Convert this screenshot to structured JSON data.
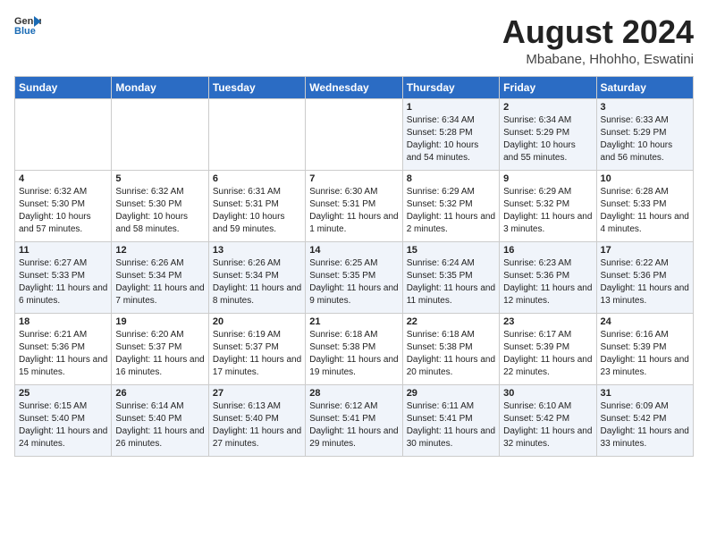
{
  "header": {
    "logo_general": "General",
    "logo_blue": "Blue",
    "month_year": "August 2024",
    "location": "Mbabane, Hhohho, Eswatini"
  },
  "weekdays": [
    "Sunday",
    "Monday",
    "Tuesday",
    "Wednesday",
    "Thursday",
    "Friday",
    "Saturday"
  ],
  "weeks": [
    [
      {
        "day": "",
        "info": ""
      },
      {
        "day": "",
        "info": ""
      },
      {
        "day": "",
        "info": ""
      },
      {
        "day": "",
        "info": ""
      },
      {
        "day": "1",
        "info": "Sunrise: 6:34 AM\nSunset: 5:28 PM\nDaylight: 10 hours and 54 minutes."
      },
      {
        "day": "2",
        "info": "Sunrise: 6:34 AM\nSunset: 5:29 PM\nDaylight: 10 hours and 55 minutes."
      },
      {
        "day": "3",
        "info": "Sunrise: 6:33 AM\nSunset: 5:29 PM\nDaylight: 10 hours and 56 minutes."
      }
    ],
    [
      {
        "day": "4",
        "info": "Sunrise: 6:32 AM\nSunset: 5:30 PM\nDaylight: 10 hours and 57 minutes."
      },
      {
        "day": "5",
        "info": "Sunrise: 6:32 AM\nSunset: 5:30 PM\nDaylight: 10 hours and 58 minutes."
      },
      {
        "day": "6",
        "info": "Sunrise: 6:31 AM\nSunset: 5:31 PM\nDaylight: 10 hours and 59 minutes."
      },
      {
        "day": "7",
        "info": "Sunrise: 6:30 AM\nSunset: 5:31 PM\nDaylight: 11 hours and 1 minute."
      },
      {
        "day": "8",
        "info": "Sunrise: 6:29 AM\nSunset: 5:32 PM\nDaylight: 11 hours and 2 minutes."
      },
      {
        "day": "9",
        "info": "Sunrise: 6:29 AM\nSunset: 5:32 PM\nDaylight: 11 hours and 3 minutes."
      },
      {
        "day": "10",
        "info": "Sunrise: 6:28 AM\nSunset: 5:33 PM\nDaylight: 11 hours and 4 minutes."
      }
    ],
    [
      {
        "day": "11",
        "info": "Sunrise: 6:27 AM\nSunset: 5:33 PM\nDaylight: 11 hours and 6 minutes."
      },
      {
        "day": "12",
        "info": "Sunrise: 6:26 AM\nSunset: 5:34 PM\nDaylight: 11 hours and 7 minutes."
      },
      {
        "day": "13",
        "info": "Sunrise: 6:26 AM\nSunset: 5:34 PM\nDaylight: 11 hours and 8 minutes."
      },
      {
        "day": "14",
        "info": "Sunrise: 6:25 AM\nSunset: 5:35 PM\nDaylight: 11 hours and 9 minutes."
      },
      {
        "day": "15",
        "info": "Sunrise: 6:24 AM\nSunset: 5:35 PM\nDaylight: 11 hours and 11 minutes."
      },
      {
        "day": "16",
        "info": "Sunrise: 6:23 AM\nSunset: 5:36 PM\nDaylight: 11 hours and 12 minutes."
      },
      {
        "day": "17",
        "info": "Sunrise: 6:22 AM\nSunset: 5:36 PM\nDaylight: 11 hours and 13 minutes."
      }
    ],
    [
      {
        "day": "18",
        "info": "Sunrise: 6:21 AM\nSunset: 5:36 PM\nDaylight: 11 hours and 15 minutes."
      },
      {
        "day": "19",
        "info": "Sunrise: 6:20 AM\nSunset: 5:37 PM\nDaylight: 11 hours and 16 minutes."
      },
      {
        "day": "20",
        "info": "Sunrise: 6:19 AM\nSunset: 5:37 PM\nDaylight: 11 hours and 17 minutes."
      },
      {
        "day": "21",
        "info": "Sunrise: 6:18 AM\nSunset: 5:38 PM\nDaylight: 11 hours and 19 minutes."
      },
      {
        "day": "22",
        "info": "Sunrise: 6:18 AM\nSunset: 5:38 PM\nDaylight: 11 hours and 20 minutes."
      },
      {
        "day": "23",
        "info": "Sunrise: 6:17 AM\nSunset: 5:39 PM\nDaylight: 11 hours and 22 minutes."
      },
      {
        "day": "24",
        "info": "Sunrise: 6:16 AM\nSunset: 5:39 PM\nDaylight: 11 hours and 23 minutes."
      }
    ],
    [
      {
        "day": "25",
        "info": "Sunrise: 6:15 AM\nSunset: 5:40 PM\nDaylight: 11 hours and 24 minutes."
      },
      {
        "day": "26",
        "info": "Sunrise: 6:14 AM\nSunset: 5:40 PM\nDaylight: 11 hours and 26 minutes."
      },
      {
        "day": "27",
        "info": "Sunrise: 6:13 AM\nSunset: 5:40 PM\nDaylight: 11 hours and 27 minutes."
      },
      {
        "day": "28",
        "info": "Sunrise: 6:12 AM\nSunset: 5:41 PM\nDaylight: 11 hours and 29 minutes."
      },
      {
        "day": "29",
        "info": "Sunrise: 6:11 AM\nSunset: 5:41 PM\nDaylight: 11 hours and 30 minutes."
      },
      {
        "day": "30",
        "info": "Sunrise: 6:10 AM\nSunset: 5:42 PM\nDaylight: 11 hours and 32 minutes."
      },
      {
        "day": "31",
        "info": "Sunrise: 6:09 AM\nSunset: 5:42 PM\nDaylight: 11 hours and 33 minutes."
      }
    ]
  ]
}
